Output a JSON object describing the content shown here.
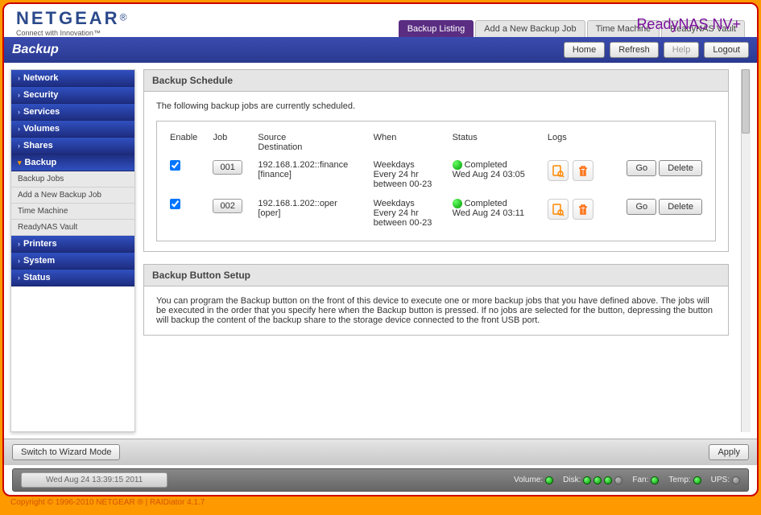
{
  "brand": {
    "name": "NETGEAR",
    "reg": "®",
    "tagline": "Connect with Innovation™"
  },
  "product": "ReadyNAS NV+",
  "tabs": [
    {
      "label": "Backup Listing",
      "active": true
    },
    {
      "label": "Add a New Backup Job",
      "active": false
    },
    {
      "label": "Time Machine",
      "active": false
    },
    {
      "label": "ReadyNAS Vault",
      "active": false
    }
  ],
  "page_title": "Backup",
  "header_buttons": {
    "home": "Home",
    "refresh": "Refresh",
    "help": "Help",
    "logout": "Logout"
  },
  "sidebar": {
    "items": [
      {
        "label": "Network",
        "type": "main"
      },
      {
        "label": "Security",
        "type": "main"
      },
      {
        "label": "Services",
        "type": "main"
      },
      {
        "label": "Volumes",
        "type": "main"
      },
      {
        "label": "Shares",
        "type": "main"
      },
      {
        "label": "Backup",
        "type": "main",
        "active": true
      },
      {
        "label": "Backup Jobs",
        "type": "sub"
      },
      {
        "label": "Add a New Backup Job",
        "type": "sub"
      },
      {
        "label": "Time Machine",
        "type": "sub"
      },
      {
        "label": "ReadyNAS Vault",
        "type": "sub"
      },
      {
        "label": "Printers",
        "type": "main"
      },
      {
        "label": "System",
        "type": "main"
      },
      {
        "label": "Status",
        "type": "main"
      }
    ]
  },
  "schedule": {
    "heading": "Backup Schedule",
    "description": "The following backup jobs are currently scheduled.",
    "cols": {
      "enable": "Enable",
      "job": "Job",
      "srcdst": "Source\nDestination",
      "when": "When",
      "status": "Status",
      "logs": "Logs"
    },
    "jobs": [
      {
        "enable": true,
        "num": "001",
        "source": "192.168.1.202::finance",
        "dest": "[finance]",
        "when1": "Weekdays",
        "when2": "Every 24 hr",
        "when3": "between 00-23",
        "status1": "Completed",
        "status2": "Wed Aug 24 03:05",
        "go": "Go",
        "delete": "Delete"
      },
      {
        "enable": true,
        "num": "002",
        "source": "192.168.1.202::oper",
        "dest": "[oper]",
        "when1": "Weekdays",
        "when2": "Every 24 hr",
        "when3": "between 00-23",
        "status1": "Completed",
        "status2": "Wed Aug 24 03:11",
        "go": "Go",
        "delete": "Delete"
      }
    ]
  },
  "button_setup": {
    "heading": "Backup Button Setup",
    "text": "You can program the Backup button on the front of this device to execute one or more backup jobs that you have defined above. The jobs will be executed in the order that you specify here when the Backup button is pressed. If no jobs are selected for the button, depressing the button will backup the content of the backup share to the storage device connected to the front USB port."
  },
  "footer": {
    "wizard": "Switch to Wizard Mode",
    "apply": "Apply",
    "timestamp": "Wed Aug 24  13:39:15 2011",
    "volume": "Volume:",
    "disk": "Disk:",
    "fan": "Fan:",
    "temp": "Temp:",
    "ups": "UPS:"
  },
  "copyright": "Copyright © 1996-2010 NETGEAR ® | RAIDiator 4.1.7"
}
